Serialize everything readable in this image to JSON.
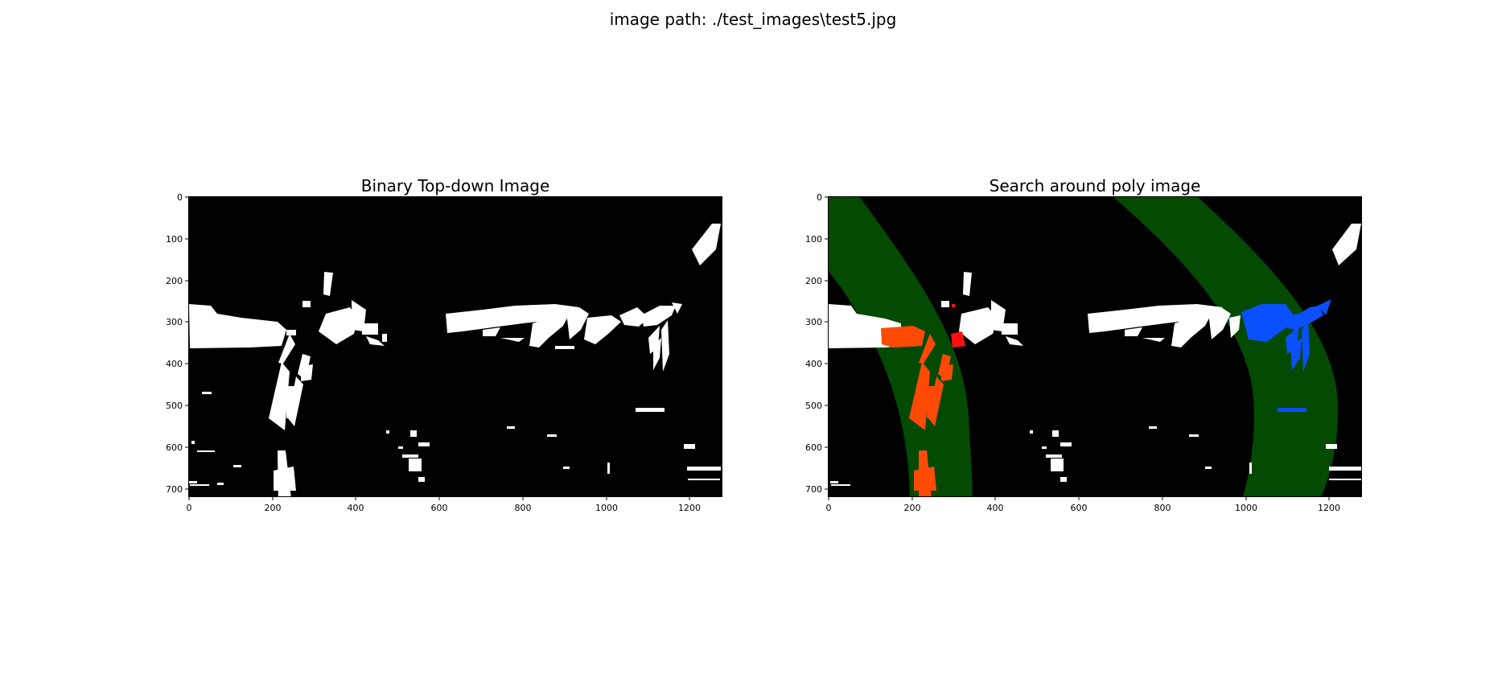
{
  "figure": {
    "suptitle": "image path: ./test_images\\test5.jpg"
  },
  "panels": [
    {
      "title": "Binary Top-down Image",
      "x_ticks": [
        "0",
        "200",
        "400",
        "600",
        "800",
        "1000",
        "1200"
      ],
      "y_ticks": [
        "0",
        "100",
        "200",
        "300",
        "400",
        "500",
        "600",
        "700"
      ],
      "x_range": [
        0,
        1280
      ],
      "y_range": [
        720,
        0
      ],
      "image_content": "binary lane-line pixels (white) on black"
    },
    {
      "title": "Search around poly image",
      "x_ticks": [
        "0",
        "200",
        "400",
        "600",
        "800",
        "1000",
        "1200"
      ],
      "y_ticks": [
        "0",
        "100",
        "200",
        "300",
        "400",
        "500",
        "600",
        "700"
      ],
      "x_range": [
        0,
        1280
      ],
      "y_range": [
        720,
        0
      ],
      "image_content": "binary pixels with green search margins, left lane pixels red, right lane pixels blue"
    }
  ],
  "colors": {
    "background": "#000000",
    "lane_pixels": "#ffffff",
    "search_region": "#034a03",
    "left_lane": "#ff4a05",
    "left_lane_alt": "#ff1010",
    "right_lane": "#0a50ff"
  }
}
